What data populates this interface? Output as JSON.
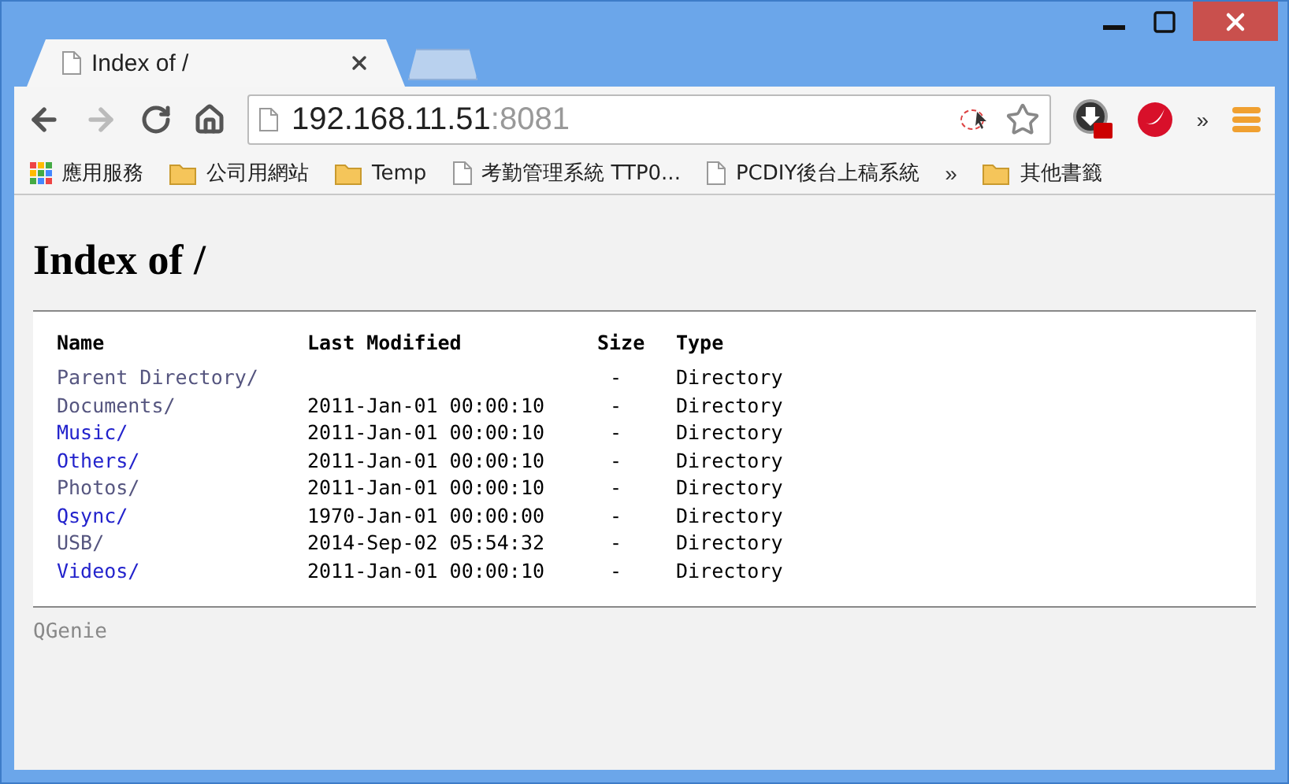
{
  "tab": {
    "title": "Index of /"
  },
  "address": {
    "host": "192.168.11.51",
    "port": ":8081"
  },
  "toolbar": {
    "overflow": "»"
  },
  "bookmarks": [
    {
      "kind": "apps",
      "label": "應用服務"
    },
    {
      "kind": "folder",
      "label": "公司用網站"
    },
    {
      "kind": "folder",
      "label": "Temp"
    },
    {
      "kind": "page",
      "label": "考勤管理系統 TTP0..."
    },
    {
      "kind": "page",
      "label": "PCDIY後台上稿系統"
    }
  ],
  "bookmarks_overflow": "»",
  "other_bookmarks": {
    "kind": "folder",
    "label": "其他書籤"
  },
  "page": {
    "heading": "Index of /",
    "columns": [
      "Name",
      "Last Modified",
      "Size",
      "Type"
    ],
    "rows": [
      {
        "name": "Parent Directory/",
        "visited": true,
        "modified": "",
        "size": "-",
        "type": "Directory"
      },
      {
        "name": "Documents/",
        "visited": true,
        "modified": "2011-Jan-01 00:00:10",
        "size": "-",
        "type": "Directory"
      },
      {
        "name": "Music/",
        "visited": false,
        "modified": "2011-Jan-01 00:00:10",
        "size": "-",
        "type": "Directory"
      },
      {
        "name": "Others/",
        "visited": false,
        "modified": "2011-Jan-01 00:00:10",
        "size": "-",
        "type": "Directory"
      },
      {
        "name": "Photos/",
        "visited": true,
        "modified": "2011-Jan-01 00:00:10",
        "size": "-",
        "type": "Directory"
      },
      {
        "name": "Qsync/",
        "visited": false,
        "modified": "1970-Jan-01 00:00:00",
        "size": "-",
        "type": "Directory"
      },
      {
        "name": "USB/",
        "visited": true,
        "modified": "2014-Sep-02 05:54:32",
        "size": "-",
        "type": "Directory"
      },
      {
        "name": "Videos/",
        "visited": false,
        "modified": "2011-Jan-01 00:00:10",
        "size": "-",
        "type": "Directory"
      }
    ],
    "footer": "QGenie"
  }
}
